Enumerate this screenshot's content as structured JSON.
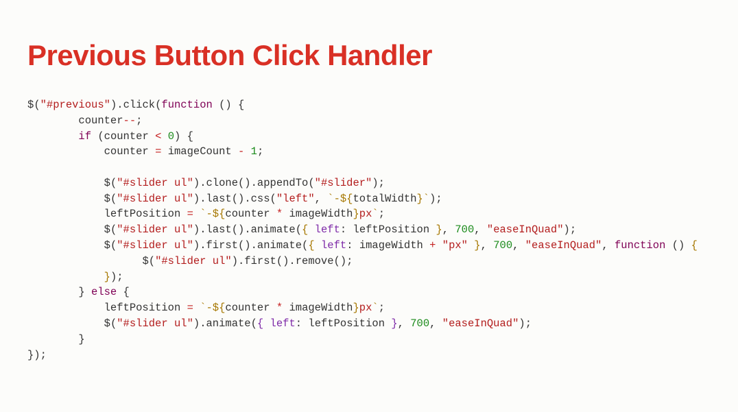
{
  "title": "Previous Button Click Handler",
  "code": {
    "t": {
      "dollar": "$",
      "previous": "\"#previous\"",
      "click": ".click",
      "function": "function",
      "counter": "counter",
      "minus2": "--",
      "if": "if",
      "op_lt": "<",
      "zero": "0",
      "eq": "=",
      "imageCount": "imageCount",
      "minus": "-",
      "one": "1",
      "sliderUl": "\"#slider ul\"",
      "clone": ".clone",
      "appendTo": ".appendTo",
      "slider": "\"#slider\"",
      "last": ".last",
      "css": ".css",
      "leftStr": "\"left\"",
      "tplOpen1": "`-${",
      "totalWidth": "totalWidth",
      "tplClose1": "}`",
      "leftPosition": "leftPosition",
      "star": "*",
      "imageWidth": "imageWidth",
      "tplCloseBrace": "}",
      "px": "px",
      "backtick": "`",
      "animate": ".animate",
      "leftKey": "left",
      "colon": ":",
      "n700": "700",
      "easeInQuad": "\"easeInQuad\"",
      "first": ".first",
      "plus": "+",
      "pxStr": "\"px\"",
      "remove": ".remove",
      "else": "else"
    }
  }
}
